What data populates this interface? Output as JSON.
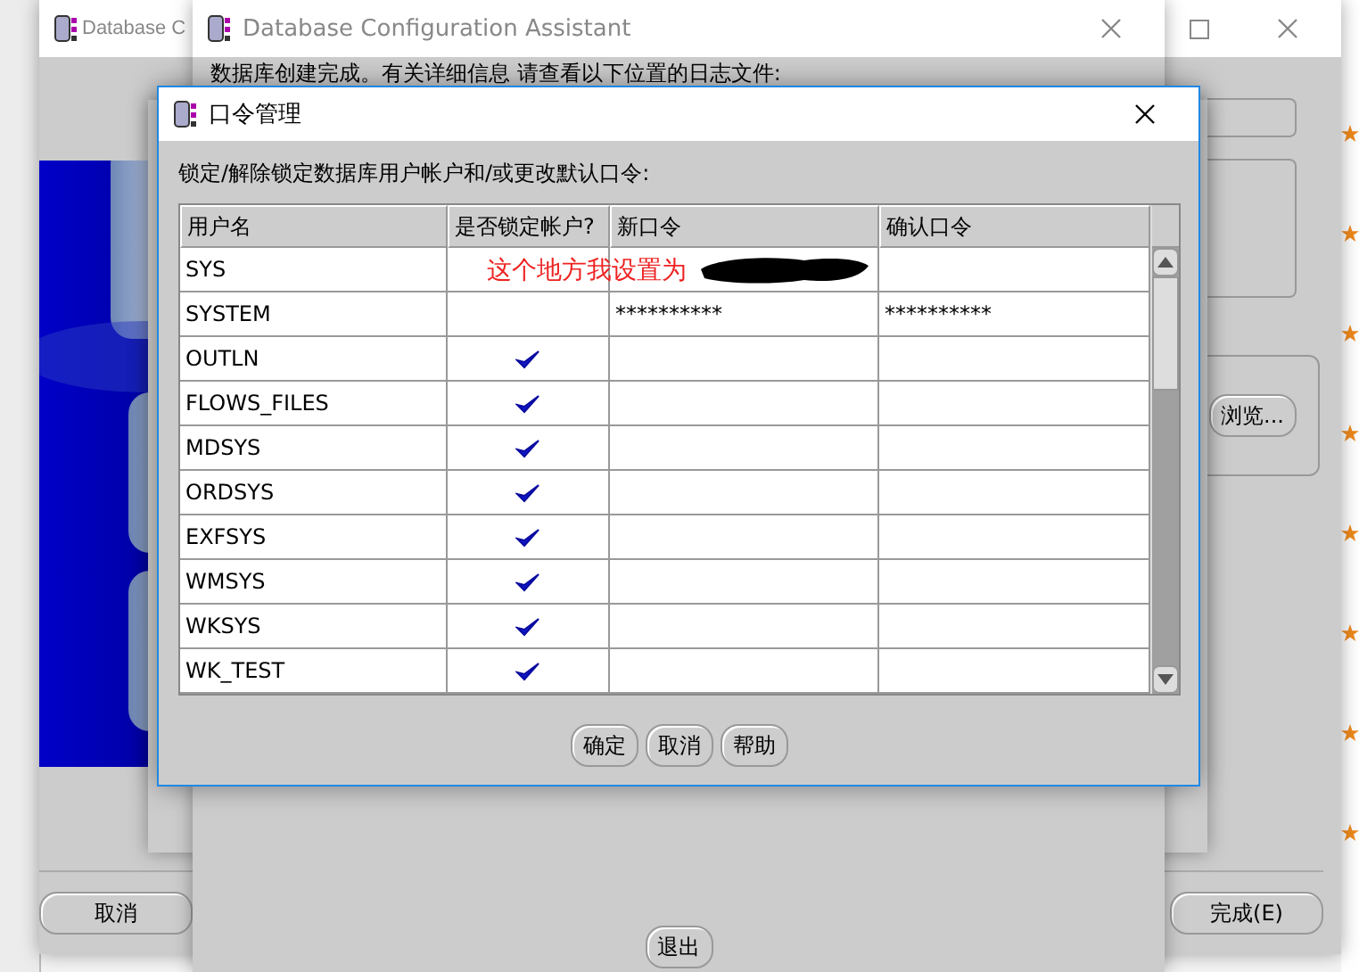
{
  "back_window": {
    "title": "Database C",
    "cancel_button": "取消",
    "finish_button": "完成(E)"
  },
  "browse_window": {
    "browse_button": "浏览..."
  },
  "main_window": {
    "title": "Database Configuration Assistant",
    "message": "数据库创建完成。有关详细信息 请查看以下位置的日志文件:",
    "exit_button": "退出"
  },
  "dialog": {
    "title": "口令管理",
    "instruction": "锁定/解除锁定数据库用户帐户和/或更改默认口令:",
    "columns": [
      "用户名",
      "是否锁定帐户?",
      "新口令",
      "确认口令"
    ],
    "rows": [
      {
        "user": "SYS",
        "locked": false,
        "annotation": {
          "text": "这个地方我设置为",
          "redacted": true
        }
      },
      {
        "user": "SYSTEM",
        "locked": false,
        "new_password": "**********",
        "confirm_password": "**********"
      },
      {
        "user": "OUTLN",
        "locked": true
      },
      {
        "user": "FLOWS_FILES",
        "locked": true
      },
      {
        "user": "MDSYS",
        "locked": true
      },
      {
        "user": "ORDSYS",
        "locked": true
      },
      {
        "user": "EXFSYS",
        "locked": true
      },
      {
        "user": "WMSYS",
        "locked": true
      },
      {
        "user": "WKSYS",
        "locked": true
      },
      {
        "user": "WK_TEST",
        "locked": true
      }
    ],
    "buttons": [
      "确定",
      "取消",
      "帮助"
    ]
  }
}
